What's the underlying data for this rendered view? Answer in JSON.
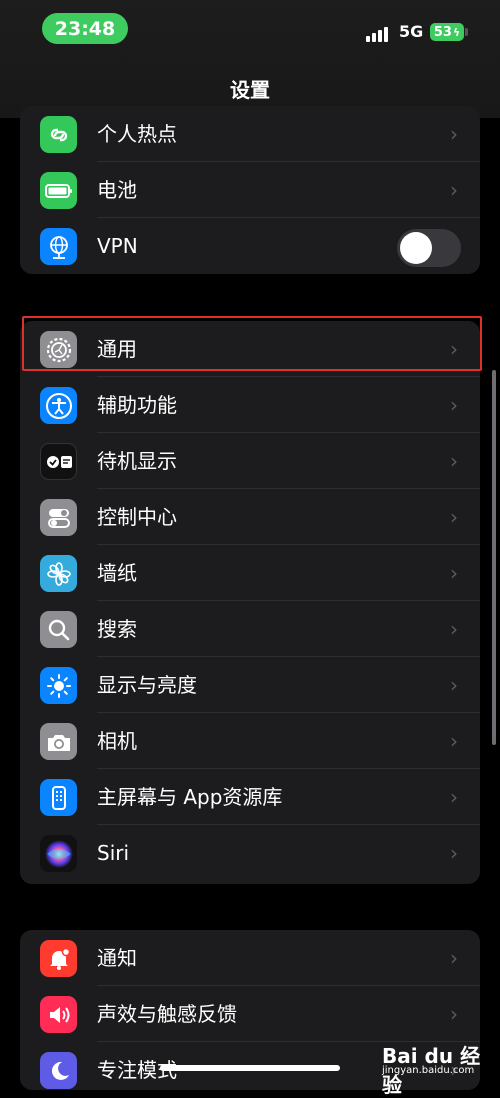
{
  "status_bar": {
    "time": "23:48",
    "network": "5G",
    "battery": "53",
    "colors": {
      "time_pill": "#3ecb5f",
      "battery": "#3ecb5f"
    }
  },
  "nav": {
    "title": "设置"
  },
  "groups": [
    {
      "rows": [
        {
          "label": "个人热点",
          "icon": "hotspot-icon",
          "color": "#34c759",
          "control": "chevron"
        },
        {
          "label": "电池",
          "icon": "battery-icon",
          "color": "#34c759",
          "control": "chevron"
        },
        {
          "label": "VPN",
          "icon": "vpn-globe-icon",
          "color": "#0a84ff",
          "control": "toggle",
          "toggle_on": false
        }
      ]
    },
    {
      "rows": [
        {
          "label": "通用",
          "icon": "gear-icon",
          "color": "#8e8e93",
          "control": "chevron",
          "highlighted": true
        },
        {
          "label": "辅助功能",
          "icon": "accessibility-icon",
          "color": "#0a84ff",
          "control": "chevron"
        },
        {
          "label": "待机显示",
          "icon": "standby-icon",
          "color": "#111111",
          "control": "chevron"
        },
        {
          "label": "控制中心",
          "icon": "control-center-icon",
          "color": "#8e8e93",
          "control": "chevron"
        },
        {
          "label": "墙纸",
          "icon": "wallpaper-flower-icon",
          "color": "#35aadc",
          "control": "chevron"
        },
        {
          "label": "搜索",
          "icon": "search-icon",
          "color": "#8e8e93",
          "control": "chevron"
        },
        {
          "label": "显示与亮度",
          "icon": "brightness-icon",
          "color": "#0a84ff",
          "control": "chevron"
        },
        {
          "label": "相机",
          "icon": "camera-icon",
          "color": "#8e8e93",
          "control": "chevron"
        },
        {
          "label": "主屏幕与 App资源库",
          "icon": "home-screen-icon",
          "color": "#0a84ff",
          "control": "chevron"
        },
        {
          "label": "Siri",
          "icon": "siri-icon",
          "color": "#222222",
          "control": "chevron"
        }
      ]
    },
    {
      "rows": [
        {
          "label": "通知",
          "icon": "notification-bell-icon",
          "color": "#ff3b30",
          "control": "chevron"
        },
        {
          "label": "声效与触感反馈",
          "icon": "sound-speaker-icon",
          "color": "#ff2d55",
          "control": "chevron"
        },
        {
          "label": "专注模式",
          "icon": "focus-moon-icon",
          "color": "#5e5ce6",
          "control": "chevron"
        }
      ]
    }
  ],
  "watermark": {
    "brand": "Bai du 经验",
    "url": "jingyan.baidu.com"
  }
}
